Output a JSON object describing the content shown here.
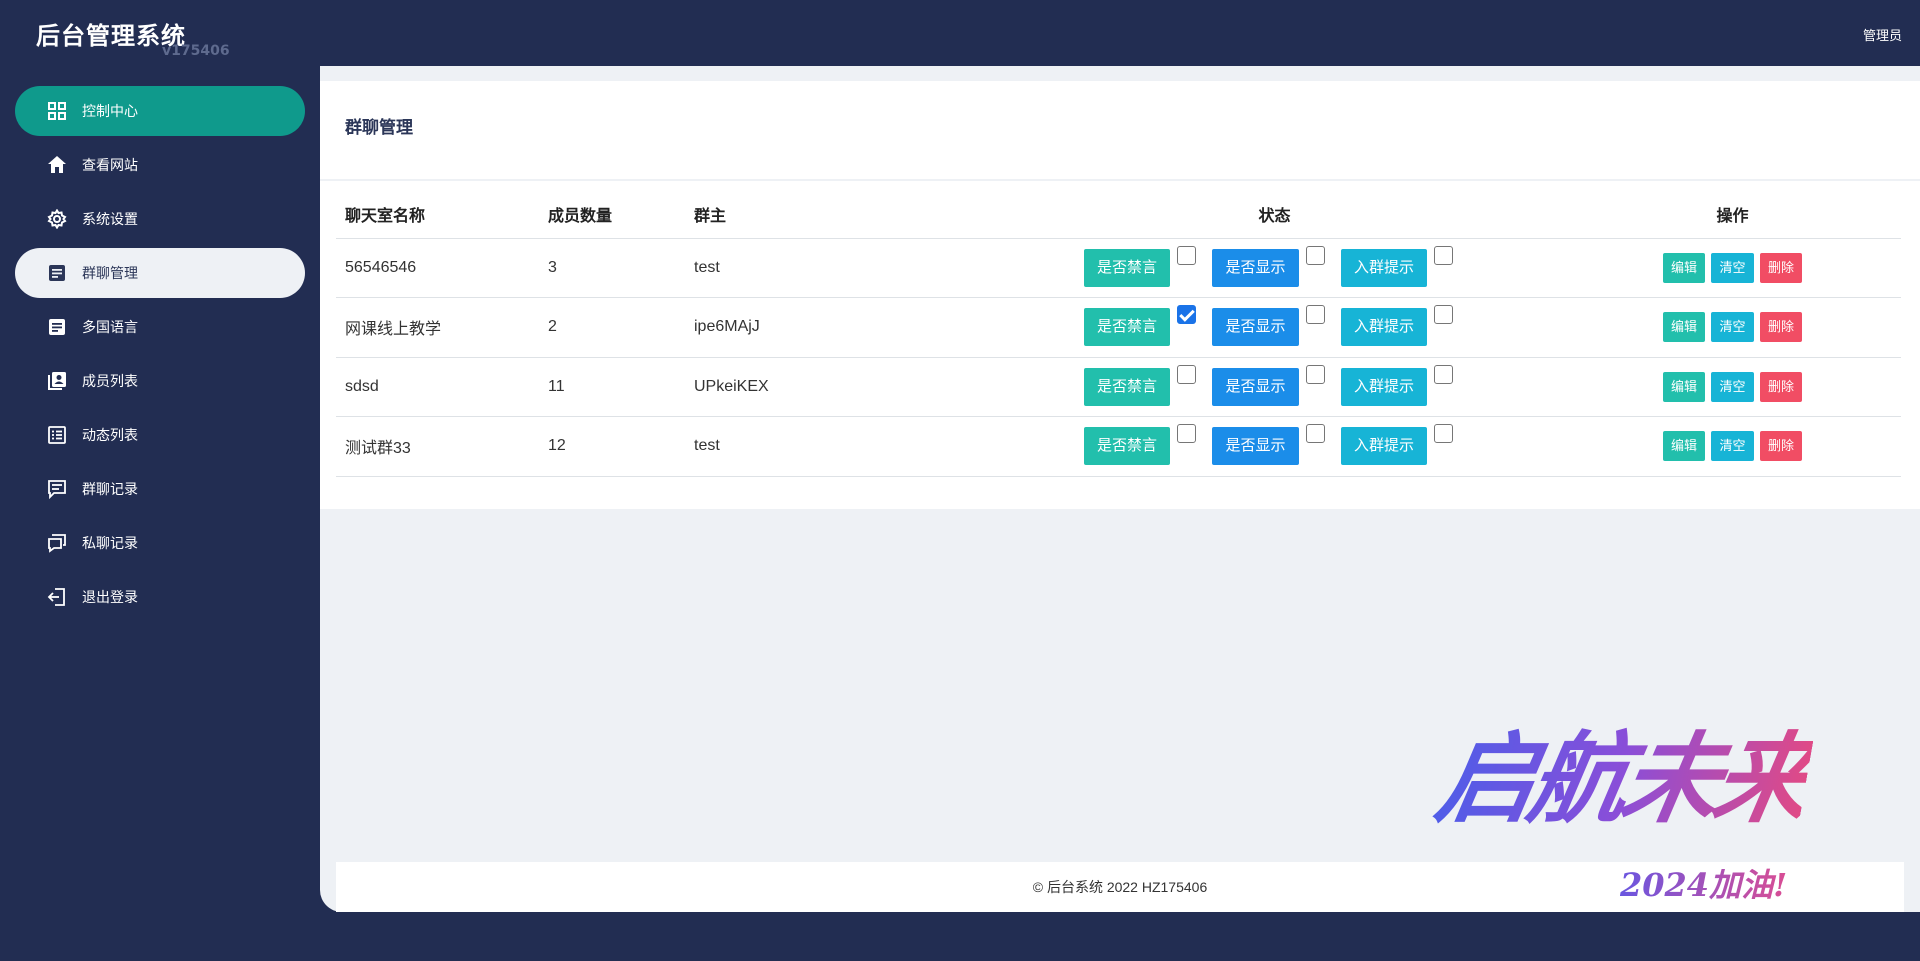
{
  "app": {
    "title": "后台管理系统",
    "version": "v175406",
    "user": "管理员"
  },
  "sidebar": {
    "items": [
      {
        "label": "控制中心",
        "icon": "dashboard-icon"
      },
      {
        "label": "查看网站",
        "icon": "home-icon"
      },
      {
        "label": "系统设置",
        "icon": "gear-icon"
      },
      {
        "label": "群聊管理",
        "icon": "document-icon"
      },
      {
        "label": "多国语言",
        "icon": "document-icon"
      },
      {
        "label": "成员列表",
        "icon": "contacts-icon"
      },
      {
        "label": "动态列表",
        "icon": "list-icon"
      },
      {
        "label": "群聊记录",
        "icon": "chat-icon"
      },
      {
        "label": "私聊记录",
        "icon": "chats-icon"
      },
      {
        "label": "退出登录",
        "icon": "logout-icon"
      }
    ]
  },
  "page": {
    "title": "群聊管理"
  },
  "table": {
    "headers": {
      "name": "聊天室名称",
      "members": "成员数量",
      "owner": "群主",
      "status": "状态",
      "actions": "操作"
    },
    "status_buttons": {
      "mute": "是否禁言",
      "show": "是否显示",
      "notice": "入群提示"
    },
    "action_buttons": {
      "edit": "编辑",
      "clear": "清空",
      "delete": "删除"
    },
    "rows": [
      {
        "name": "56546546",
        "members": "3",
        "owner": "test",
        "mute": false,
        "show": false,
        "notice": false
      },
      {
        "name": "网课线上教学",
        "members": "2",
        "owner": "ipe6MAjJ",
        "mute": true,
        "show": false,
        "notice": false
      },
      {
        "name": "sdsd",
        "members": "11",
        "owner": "UPkeiKEX",
        "mute": false,
        "show": false,
        "notice": false
      },
      {
        "name": "测试群33",
        "members": "12",
        "owner": "test",
        "mute": false,
        "show": false,
        "notice": false
      }
    ]
  },
  "footer": {
    "text": "© 后台系统 2022 HZ175406"
  },
  "watermark": {
    "main": "启航未来",
    "sub": "2024加油!"
  },
  "colors": {
    "sidebar_bg": "#222d52",
    "active_green": "#0f9a8c",
    "teal": "#22bfac",
    "blue": "#1b8de9",
    "cyan": "#17b4d6",
    "danger": "#f14d64"
  }
}
